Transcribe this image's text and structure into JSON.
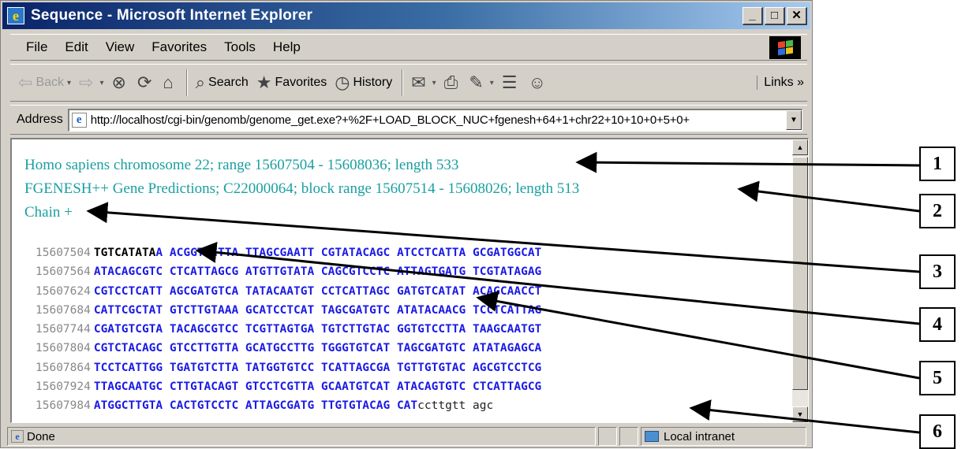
{
  "window": {
    "title": "Sequence - Microsoft Internet Explorer",
    "app_icon_glyph": "e"
  },
  "window_controls": {
    "minimize": "_",
    "maximize": "□",
    "close": "✕"
  },
  "menubar": {
    "items": [
      "File",
      "Edit",
      "View",
      "Favorites",
      "Tools",
      "Help"
    ]
  },
  "toolbar": {
    "back_label": "Back",
    "back_icon": "⇦",
    "forward_icon": "⇨",
    "stop_icon": "⊗",
    "refresh_icon": "⟳",
    "home_icon": "⌂",
    "search_label": "Search",
    "search_icon": "⌕",
    "favorites_label": "Favorites",
    "favorites_icon": "★",
    "history_label": "History",
    "history_icon": "◷",
    "mail_icon": "✉",
    "print_icon": "⎙",
    "edit_icon": "✎",
    "discuss_icon": "☰",
    "messenger_icon": "☺",
    "dropdown_glyph": "▾",
    "links_label": "Links »"
  },
  "address": {
    "label": "Address",
    "url": "http://localhost/cgi-bin/genomb/genome_get.exe?+%2F+LOAD_BLOCK_NUC+fgenesh+64+1+chr22+10+10+0+5+0+",
    "page_icon_glyph": "e",
    "dropdown_glyph": "▼"
  },
  "content": {
    "line1": "Homo sapiens chromosome 22; range 15607504 - 15608036; length 533",
    "line2": "FGENESH++ Gene Predictions; C22000064; block range 15607514 - 15608026; length 513",
    "line3": "Chain +",
    "sequence_rows": [
      {
        "pos": "15607504",
        "segments": [
          {
            "t": "TGTCATATA",
            "c": "b-black"
          },
          {
            "t": "A ACGGTCCTTA TTAGCGAATT CGTATACAGC ATCCTCATTA GCGATGGCAT",
            "c": "b-blue"
          }
        ]
      },
      {
        "pos": "15607564",
        "segments": [
          {
            "t": "ATACAGCGTC CTCATTAGCG ATGTTGTATA CAGCGTCCTC ATTAGTGATG TCGTATAGAG",
            "c": "b-blue"
          }
        ]
      },
      {
        "pos": "15607624",
        "segments": [
          {
            "t": "CGTCCTCATT AGCGATGTCA TATACAATGT CCTCATTAGC GATGTCATAT ACAGCAACCT",
            "c": "b-blue"
          }
        ]
      },
      {
        "pos": "15607684",
        "segments": [
          {
            "t": "CATTCGCTAT GTCTTGTAAA GCATCCTCAT TAGCGATGTC ATATACAACG TCCTCATTAG",
            "c": "b-blue"
          }
        ]
      },
      {
        "pos": "15607744",
        "segments": [
          {
            "t": "CGATGTCGTA TACAGCGTCC TCGTTAGTGA TGTCTTGTAC GGTGTCCTTA TAAGCAATGT",
            "c": "b-blue"
          }
        ]
      },
      {
        "pos": "15607804",
        "segments": [
          {
            "t": "CGTCTACAGC GTCCTTGTTA GCATGCCTTG TGGGTGTCAT TAGCGATGTC ATATAGAGCA",
            "c": "b-blue"
          }
        ]
      },
      {
        "pos": "15607864",
        "segments": [
          {
            "t": "TCCTCATTGG TGATGTCTTA TATGGTGTCC TCATTAGCGA TGTTGTGTAC AGCGTCCTCG",
            "c": "b-blue"
          }
        ]
      },
      {
        "pos": "15607924",
        "segments": [
          {
            "t": "TTAGCAATGC CTTGTACAGT GTCCTCGTTA GCAATGTCAT ATACAGTGTC CTCATTAGCG",
            "c": "b-blue"
          }
        ]
      },
      {
        "pos": "15607984",
        "segments": [
          {
            "t": "ATGGCTTGTA CACTGTCCTC ATTAGCGATG TTGTGTACAG CAT",
            "c": "b-blue"
          },
          {
            "t": "ccttgtt agc",
            "c": "tail"
          }
        ]
      }
    ]
  },
  "statusbar": {
    "status": "Done",
    "zone": "Local intranet"
  },
  "callouts": [
    "1",
    "2",
    "3",
    "4",
    "5",
    "6"
  ],
  "colors": {
    "info_text": "#1a9fa0",
    "sequence_blue": "#1a1ae6",
    "titlebar": "#0a246a"
  }
}
